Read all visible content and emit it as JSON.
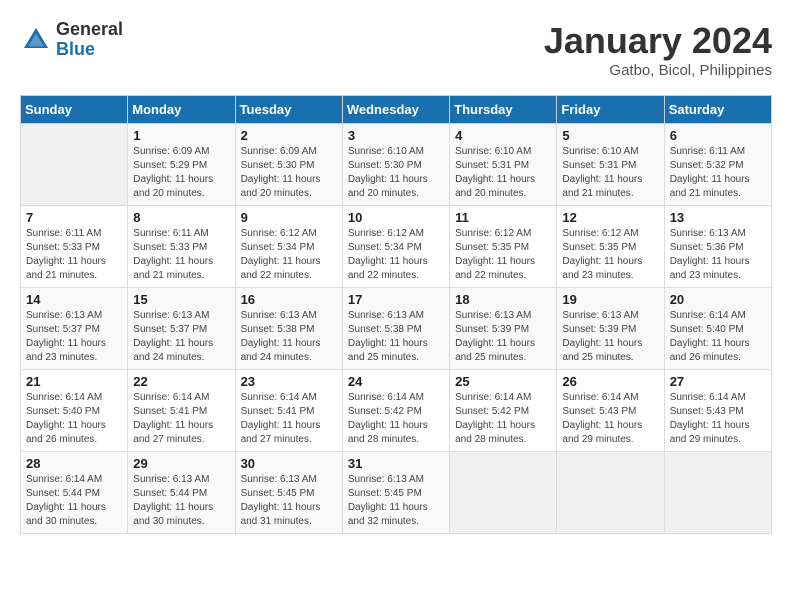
{
  "header": {
    "logo_general": "General",
    "logo_blue": "Blue",
    "calendar_title": "January 2024",
    "calendar_subtitle": "Gatbo, Bicol, Philippines"
  },
  "days_of_week": [
    "Sunday",
    "Monday",
    "Tuesday",
    "Wednesday",
    "Thursday",
    "Friday",
    "Saturday"
  ],
  "weeks": [
    [
      {
        "day": "",
        "sunrise": "",
        "sunset": "",
        "daylight": ""
      },
      {
        "day": "1",
        "sunrise": "Sunrise: 6:09 AM",
        "sunset": "Sunset: 5:29 PM",
        "daylight": "Daylight: 11 hours and 20 minutes."
      },
      {
        "day": "2",
        "sunrise": "Sunrise: 6:09 AM",
        "sunset": "Sunset: 5:30 PM",
        "daylight": "Daylight: 11 hours and 20 minutes."
      },
      {
        "day": "3",
        "sunrise": "Sunrise: 6:10 AM",
        "sunset": "Sunset: 5:30 PM",
        "daylight": "Daylight: 11 hours and 20 minutes."
      },
      {
        "day": "4",
        "sunrise": "Sunrise: 6:10 AM",
        "sunset": "Sunset: 5:31 PM",
        "daylight": "Daylight: 11 hours and 20 minutes."
      },
      {
        "day": "5",
        "sunrise": "Sunrise: 6:10 AM",
        "sunset": "Sunset: 5:31 PM",
        "daylight": "Daylight: 11 hours and 21 minutes."
      },
      {
        "day": "6",
        "sunrise": "Sunrise: 6:11 AM",
        "sunset": "Sunset: 5:32 PM",
        "daylight": "Daylight: 11 hours and 21 minutes."
      }
    ],
    [
      {
        "day": "7",
        "sunrise": "Sunrise: 6:11 AM",
        "sunset": "Sunset: 5:33 PM",
        "daylight": "Daylight: 11 hours and 21 minutes."
      },
      {
        "day": "8",
        "sunrise": "Sunrise: 6:11 AM",
        "sunset": "Sunset: 5:33 PM",
        "daylight": "Daylight: 11 hours and 21 minutes."
      },
      {
        "day": "9",
        "sunrise": "Sunrise: 6:12 AM",
        "sunset": "Sunset: 5:34 PM",
        "daylight": "Daylight: 11 hours and 22 minutes."
      },
      {
        "day": "10",
        "sunrise": "Sunrise: 6:12 AM",
        "sunset": "Sunset: 5:34 PM",
        "daylight": "Daylight: 11 hours and 22 minutes."
      },
      {
        "day": "11",
        "sunrise": "Sunrise: 6:12 AM",
        "sunset": "Sunset: 5:35 PM",
        "daylight": "Daylight: 11 hours and 22 minutes."
      },
      {
        "day": "12",
        "sunrise": "Sunrise: 6:12 AM",
        "sunset": "Sunset: 5:35 PM",
        "daylight": "Daylight: 11 hours and 23 minutes."
      },
      {
        "day": "13",
        "sunrise": "Sunrise: 6:13 AM",
        "sunset": "Sunset: 5:36 PM",
        "daylight": "Daylight: 11 hours and 23 minutes."
      }
    ],
    [
      {
        "day": "14",
        "sunrise": "Sunrise: 6:13 AM",
        "sunset": "Sunset: 5:37 PM",
        "daylight": "Daylight: 11 hours and 23 minutes."
      },
      {
        "day": "15",
        "sunrise": "Sunrise: 6:13 AM",
        "sunset": "Sunset: 5:37 PM",
        "daylight": "Daylight: 11 hours and 24 minutes."
      },
      {
        "day": "16",
        "sunrise": "Sunrise: 6:13 AM",
        "sunset": "Sunset: 5:38 PM",
        "daylight": "Daylight: 11 hours and 24 minutes."
      },
      {
        "day": "17",
        "sunrise": "Sunrise: 6:13 AM",
        "sunset": "Sunset: 5:38 PM",
        "daylight": "Daylight: 11 hours and 25 minutes."
      },
      {
        "day": "18",
        "sunrise": "Sunrise: 6:13 AM",
        "sunset": "Sunset: 5:39 PM",
        "daylight": "Daylight: 11 hours and 25 minutes."
      },
      {
        "day": "19",
        "sunrise": "Sunrise: 6:13 AM",
        "sunset": "Sunset: 5:39 PM",
        "daylight": "Daylight: 11 hours and 25 minutes."
      },
      {
        "day": "20",
        "sunrise": "Sunrise: 6:14 AM",
        "sunset": "Sunset: 5:40 PM",
        "daylight": "Daylight: 11 hours and 26 minutes."
      }
    ],
    [
      {
        "day": "21",
        "sunrise": "Sunrise: 6:14 AM",
        "sunset": "Sunset: 5:40 PM",
        "daylight": "Daylight: 11 hours and 26 minutes."
      },
      {
        "day": "22",
        "sunrise": "Sunrise: 6:14 AM",
        "sunset": "Sunset: 5:41 PM",
        "daylight": "Daylight: 11 hours and 27 minutes."
      },
      {
        "day": "23",
        "sunrise": "Sunrise: 6:14 AM",
        "sunset": "Sunset: 5:41 PM",
        "daylight": "Daylight: 11 hours and 27 minutes."
      },
      {
        "day": "24",
        "sunrise": "Sunrise: 6:14 AM",
        "sunset": "Sunset: 5:42 PM",
        "daylight": "Daylight: 11 hours and 28 minutes."
      },
      {
        "day": "25",
        "sunrise": "Sunrise: 6:14 AM",
        "sunset": "Sunset: 5:42 PM",
        "daylight": "Daylight: 11 hours and 28 minutes."
      },
      {
        "day": "26",
        "sunrise": "Sunrise: 6:14 AM",
        "sunset": "Sunset: 5:43 PM",
        "daylight": "Daylight: 11 hours and 29 minutes."
      },
      {
        "day": "27",
        "sunrise": "Sunrise: 6:14 AM",
        "sunset": "Sunset: 5:43 PM",
        "daylight": "Daylight: 11 hours and 29 minutes."
      }
    ],
    [
      {
        "day": "28",
        "sunrise": "Sunrise: 6:14 AM",
        "sunset": "Sunset: 5:44 PM",
        "daylight": "Daylight: 11 hours and 30 minutes."
      },
      {
        "day": "29",
        "sunrise": "Sunrise: 6:13 AM",
        "sunset": "Sunset: 5:44 PM",
        "daylight": "Daylight: 11 hours and 30 minutes."
      },
      {
        "day": "30",
        "sunrise": "Sunrise: 6:13 AM",
        "sunset": "Sunset: 5:45 PM",
        "daylight": "Daylight: 11 hours and 31 minutes."
      },
      {
        "day": "31",
        "sunrise": "Sunrise: 6:13 AM",
        "sunset": "Sunset: 5:45 PM",
        "daylight": "Daylight: 11 hours and 32 minutes."
      },
      {
        "day": "",
        "sunrise": "",
        "sunset": "",
        "daylight": ""
      },
      {
        "day": "",
        "sunrise": "",
        "sunset": "",
        "daylight": ""
      },
      {
        "day": "",
        "sunrise": "",
        "sunset": "",
        "daylight": ""
      }
    ]
  ]
}
